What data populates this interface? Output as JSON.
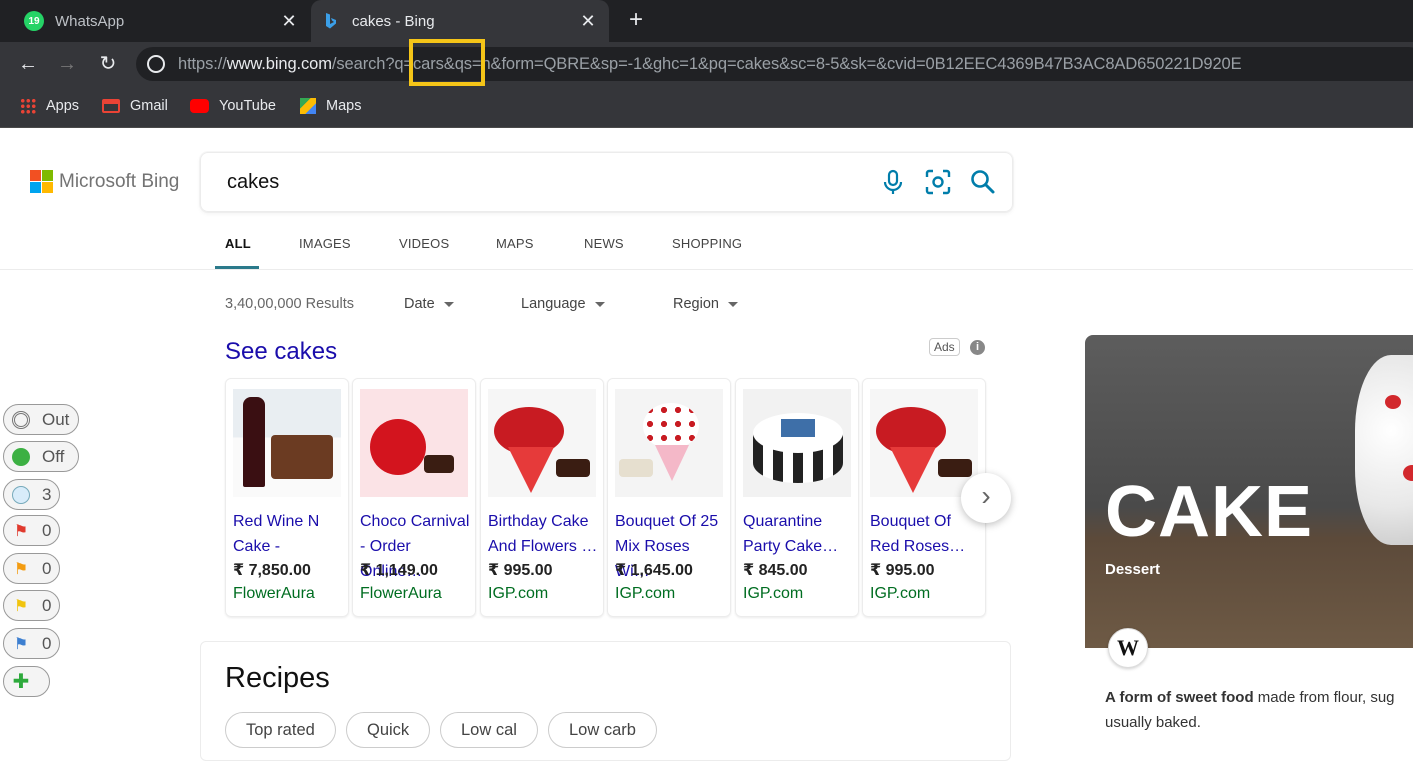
{
  "browser": {
    "tabs": [
      {
        "title": "WhatsApp",
        "badge": "19"
      },
      {
        "title": "cakes - Bing"
      }
    ],
    "url": {
      "scheme": "https://",
      "host": "www.bing.com",
      "rest": "/search?q=cars&qs=n&form=QBRE&sp=-1&ghc=1&pq=cakes&sc=8-5&sk=&cvid=0B12EEC4369B47B3AC8AD650221D920E"
    },
    "bookmarks": [
      "Apps",
      "Gmail",
      "YouTube",
      "Maps"
    ]
  },
  "bing": {
    "brand": "Microsoft Bing",
    "query": "cakes",
    "tabs": [
      "ALL",
      "IMAGES",
      "VIDEOS",
      "MAPS",
      "NEWS",
      "SHOPPING"
    ],
    "results_count": "3,40,00,000 Results",
    "filters": [
      "Date",
      "Language",
      "Region"
    ],
    "see_heading": "See cakes",
    "ads_label": "Ads",
    "ads_info": "i",
    "products": [
      {
        "title": "Red Wine N Cake -",
        "price": "₹ 7,850.00",
        "source": "FlowerAura"
      },
      {
        "title": "Choco Carnival - Order Online…",
        "price": "₹ 1,149.00",
        "source": "FlowerAura"
      },
      {
        "title": "Birthday Cake And Flowers …",
        "price": "₹ 995.00",
        "source": "IGP.com"
      },
      {
        "title": "Bouquet Of 25 Mix Roses Wi…",
        "price": "₹ 1,645.00",
        "source": "IGP.com"
      },
      {
        "title": "Quarantine Party Cake…",
        "price": "₹ 845.00",
        "source": "IGP.com"
      },
      {
        "title": "Bouquet Of Red Roses…",
        "price": "₹ 995.00",
        "source": "IGP.com"
      }
    ],
    "recipes_title": "Recipes",
    "recipe_chips": [
      "Top rated",
      "Quick",
      "Low cal",
      "Low carb"
    ]
  },
  "side_widgets": [
    "Out",
    "Off",
    "3",
    "0",
    "0",
    "0",
    "0"
  ],
  "knowledge_panel": {
    "title": "CAKE",
    "subtitle": "Dessert",
    "wiki_letter": "W",
    "desc_bold": "A form of sweet food",
    "desc_rest": " made from flour, sug usually baked."
  },
  "colors": {
    "link": "#1a0dab",
    "source": "#006d21",
    "highlight": "#f5c518"
  }
}
